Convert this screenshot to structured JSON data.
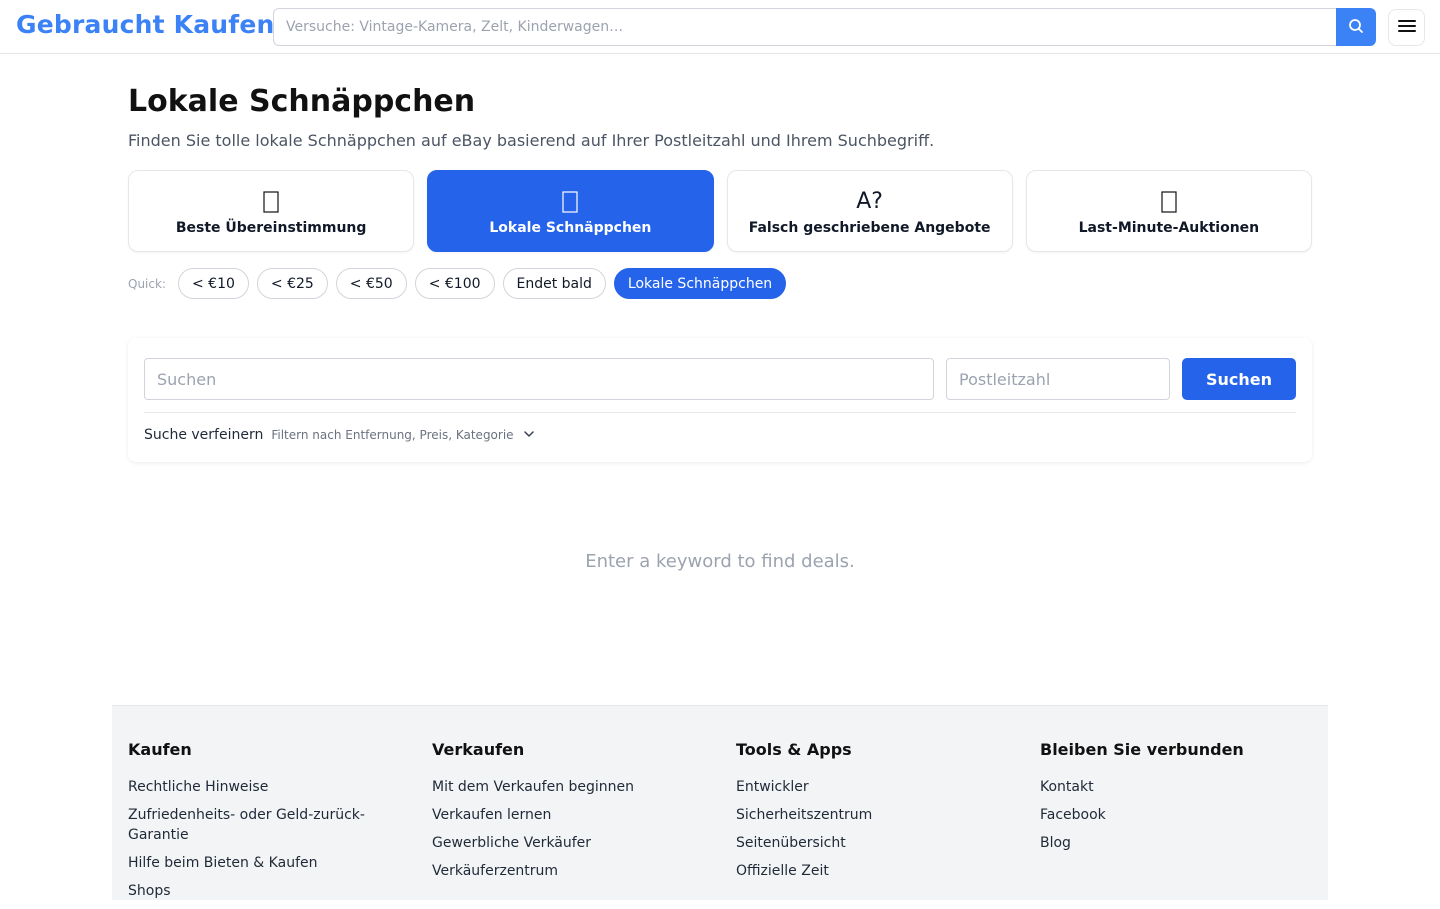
{
  "header": {
    "brand": "Gebraucht Kaufen",
    "search_placeholder": "Versuche: Vintage-Kamera, Zelt, Kinderwagen…",
    "search_icon": "search-icon",
    "menu_icon": "hamburger-menu-icon"
  },
  "main": {
    "title": "Lokale Schnäppchen",
    "subtitle": "Finden Sie tolle lokale Schnäppchen auf eBay basierend auf Ihrer Postleitzahl und Ihrem Suchbegriff.",
    "modes": [
      {
        "label": "Beste Übereinstimmung",
        "icon": "target-icon",
        "active": false
      },
      {
        "label": "Lokale Schnäppchen",
        "icon": "location-pin-icon",
        "active": true
      },
      {
        "label": "Falsch geschriebene Angebote",
        "icon_text": "A?",
        "active": false
      },
      {
        "label": "Last-Minute-Auktionen",
        "icon": "clock-icon",
        "active": false
      }
    ],
    "quick": {
      "label": "Quick:",
      "chips": [
        "< €10",
        "< €25",
        "< €50",
        "< €100",
        "Endet bald",
        "Lokale Schnäppchen"
      ],
      "active_index": 5
    },
    "search": {
      "keyword_placeholder": "Suchen",
      "zip_placeholder": "Postleitzahl",
      "button": "Suchen",
      "refine_title": "Suche verfeinern",
      "refine_hint": "Filtern nach Entfernung, Preis, Kategorie"
    },
    "empty_message": "Enter a keyword to find deals."
  },
  "footer": {
    "columns": [
      {
        "title": "Kaufen",
        "links": [
          "Rechtliche Hinweise",
          "Zufriedenheits- oder Geld-zurück-Garantie",
          "Hilfe beim Bieten & Kaufen",
          "Shops"
        ]
      },
      {
        "title": "Verkaufen",
        "links": [
          "Mit dem Verkaufen beginnen",
          "Verkaufen lernen",
          "Gewerbliche Verkäufer",
          "Verkäuferzentrum"
        ]
      },
      {
        "title": "Tools & Apps",
        "links": [
          "Entwickler",
          "Sicherheitszentrum",
          "Seitenübersicht",
          "Offizielle Zeit"
        ]
      },
      {
        "title": "Bleiben Sie verbunden",
        "links": [
          "Kontakt",
          "Facebook",
          "Blog"
        ]
      }
    ]
  },
  "colors": {
    "brand": "#3b82f6",
    "accent": "#2563eb",
    "footer_bg": "#f3f4f6"
  }
}
